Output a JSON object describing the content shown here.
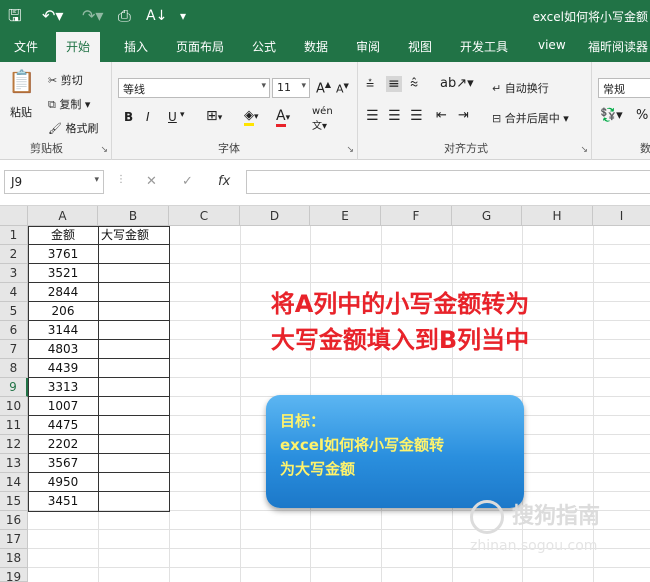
{
  "window": {
    "title": "excel如何将小写金额"
  },
  "quick_access": {
    "save_icon": "save-icon",
    "undo_icon": "undo-icon",
    "redo_icon": "redo-icon",
    "preview_icon": "print-preview-icon",
    "sort_icon": "sort-icon",
    "more_icon": "customize-icon"
  },
  "tabs": [
    {
      "label": "文件"
    },
    {
      "label": "开始"
    },
    {
      "label": "插入"
    },
    {
      "label": "页面布局"
    },
    {
      "label": "公式"
    },
    {
      "label": "数据"
    },
    {
      "label": "审阅"
    },
    {
      "label": "视图"
    },
    {
      "label": "开发工具"
    },
    {
      "label": "view"
    },
    {
      "label": "福昕阅读器"
    }
  ],
  "ribbon": {
    "clipboard": {
      "label": "剪贴板",
      "paste": "粘贴",
      "cut": "剪切",
      "copy": "复制",
      "format_painter": "格式刷"
    },
    "font": {
      "label": "字体",
      "name": "等线",
      "size": "11",
      "bold": "B",
      "italic": "I",
      "underline": "U"
    },
    "alignment": {
      "label": "对齐方式",
      "wrap": "自动换行",
      "merge": "合并后居中"
    },
    "number": {
      "format": "常规",
      "label": "数"
    }
  },
  "formula_bar": {
    "name_box": "J9",
    "cancel": "✕",
    "enter": "✓",
    "fx": "fx",
    "value": ""
  },
  "columns": [
    "A",
    "B",
    "C",
    "D",
    "E",
    "F",
    "G",
    "H",
    "I"
  ],
  "rows": [
    "1",
    "2",
    "3",
    "4",
    "5",
    "6",
    "7",
    "8",
    "9",
    "10",
    "11",
    "12",
    "13",
    "14",
    "15",
    "16",
    "17",
    "18",
    "19"
  ],
  "selected_row": "9",
  "table": {
    "header_a": "金额",
    "header_b": "大写金额",
    "amounts": [
      "3761",
      "3521",
      "2844",
      "206",
      "3144",
      "4803",
      "4439",
      "3313",
      "1007",
      "4475",
      "2202",
      "3567",
      "4950",
      "3451"
    ]
  },
  "annotation": {
    "line1": "将A列中的小写金额转为",
    "line2": "大写金额填入到B列当中"
  },
  "callout": {
    "line1": "目标：",
    "line2": "excel如何将小写金额转",
    "line3": "为大写金额"
  },
  "watermark": {
    "text": "搜狗指南",
    "sub": "zhinan.sogou.com"
  }
}
